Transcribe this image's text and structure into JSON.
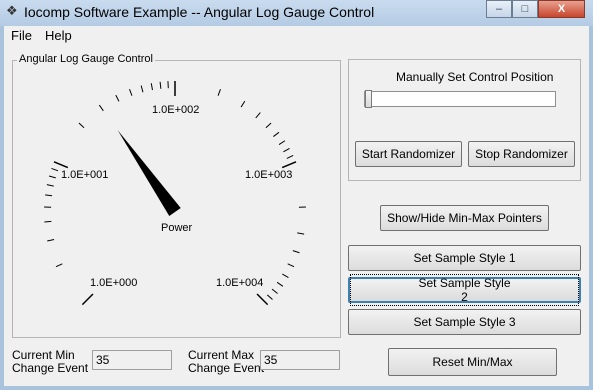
{
  "window": {
    "title": "Iocomp Software Example -- Angular Log Gauge Control",
    "controls": {
      "minimize": "–",
      "maximize": "□",
      "close": "X"
    }
  },
  "menu": [
    {
      "label": "File"
    },
    {
      "label": "Help"
    }
  ],
  "gauge_group": {
    "title": "Angular Log Gauge Control",
    "gauge": {
      "label": "Power",
      "scale": "log",
      "tick_labels": [
        "1.0E+000",
        "1.0E+001",
        "1.0E+002",
        "1.0E+003",
        "1.0E+004"
      ],
      "pointer_value_label": "1.0E+001"
    }
  },
  "position_group": {
    "title": "Manually Set Control Position",
    "start_button": "Start Randomizer",
    "stop_button": "Stop Randomizer"
  },
  "buttons": {
    "show_hide": "Show/Hide Min-Max Pointers",
    "style1": "Set Sample Style 1",
    "style2": "Set Sample Style 2",
    "style3": "Set Sample Style 3",
    "reset": "Reset Min/Max"
  },
  "status": {
    "min_label_1": "Current Min",
    "min_label_2": "Change Event",
    "min_value": "35",
    "max_label_1": "Current Max",
    "max_label_2": "Change Event",
    "max_value": "35"
  }
}
